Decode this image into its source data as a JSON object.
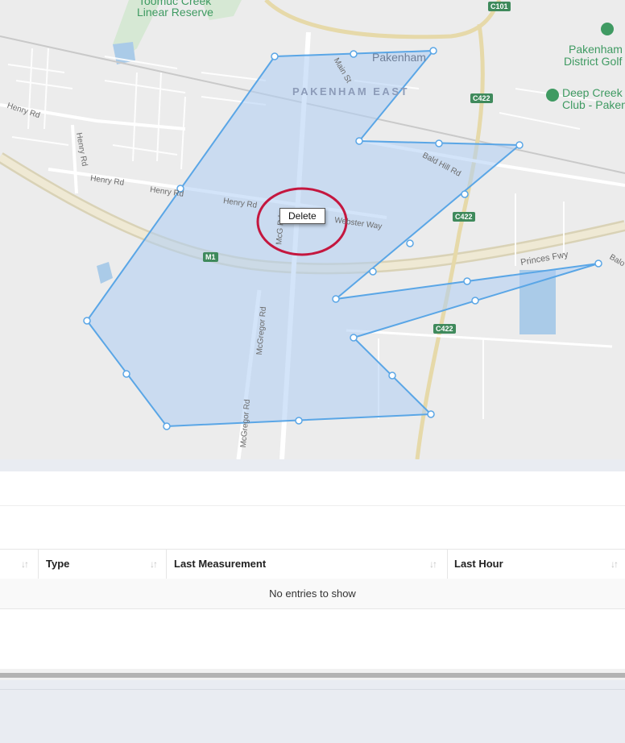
{
  "map": {
    "labels": {
      "toomuc_line1": "Toomuc Creek",
      "toomuc_line2": "Linear Reserve",
      "pakenham": "Pakenham",
      "pakenham_east": "PAKENHAM EAST",
      "golf_line1": "Pakenham",
      "golf_line2": "District Golf",
      "deep_creek_line1": "Deep Creek C",
      "deep_creek_line2": "Club - Paken",
      "henry_rd_1": "Henry Rd",
      "henry_rd_2": "Henry Rd",
      "henry_rd_3": "Henry Rd",
      "henry_rd_4": "Henry Rd",
      "henry_rd_5": "Henry Rd",
      "main_st": "Main St",
      "bald_hill_rd": "Bald Hill Rd",
      "webster_way": "Webster Way",
      "mcgregor_rd_1": "McGregor Rd",
      "mcgregor_rd_2": "McGregor Rd",
      "mcgregor_rd_3": "McG Rd",
      "princes_fwy": "Princes Fwy",
      "balo": "Balo"
    },
    "shields": {
      "c101": "C101",
      "c422_1": "C422",
      "c422_2": "C422",
      "c422_3": "C422",
      "m1": "M1"
    },
    "delete_tooltip": "Delete",
    "colors": {
      "polygon_fill": "#aecdf4",
      "polygon_stroke": "#5aa6e6",
      "highlight_circle": "#c4173f"
    }
  },
  "table": {
    "columns": [
      {
        "label": ""
      },
      {
        "label": "Type"
      },
      {
        "label": "Last Measurement"
      },
      {
        "label": "Last Hour"
      }
    ],
    "empty_message": "No entries to show"
  }
}
